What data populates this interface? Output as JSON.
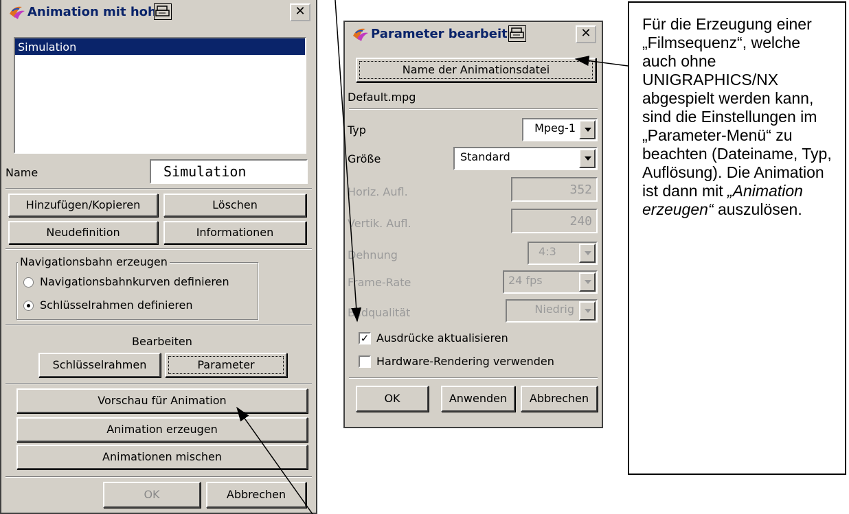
{
  "dialog1": {
    "title": "Animation mit hoher Bildqual",
    "list_items": [
      "Simulation"
    ],
    "name_label": "Name",
    "name_value": "Simulation",
    "btn_add_copy": "Hinzufügen/Kopieren",
    "btn_delete": "Löschen",
    "btn_redefine": "Neudefinition",
    "btn_info": "Informationen",
    "group_title": "Navigationsbahn erzeugen",
    "radio_curves": "Navigationsbahnkurven definieren",
    "radio_keyframes": "Schlüsselrahmen definieren",
    "edit_label": "Bearbeiten",
    "btn_keyframes": "Schlüsselrahmen",
    "btn_parameter": "Parameter",
    "btn_preview": "Vorschau für Animation",
    "btn_create": "Animation erzeugen",
    "btn_mix": "Animationen mischen",
    "btn_ok": "OK",
    "btn_cancel": "Abbrechen"
  },
  "dialog2": {
    "title": "Parameter bearbeit",
    "btn_filename": "Name der Animationsdatei",
    "filename": "Default.mpg",
    "type_label": "Typ",
    "type_value": "Mpeg-1",
    "size_label": "Größe",
    "size_value": "Standard",
    "hres_label": "Horiz. Aufl.",
    "hres_value": "352",
    "vres_label": "Vertik. Aufl.",
    "vres_value": "240",
    "aspect_label": "Dehnung",
    "aspect_value": "4:3",
    "framerate_label": "Frame-Rate",
    "framerate_value": "24 fps",
    "quality_label": "Bildqualität",
    "quality_value": "Niedrig",
    "cb_expressions": "Ausdrücke aktualisieren",
    "cb_expressions_checked": true,
    "cb_hardware": "Hardware-Rendering verwenden",
    "cb_hardware_checked": false,
    "btn_ok": "OK",
    "btn_apply": "Anwenden",
    "btn_cancel": "Abbrechen"
  },
  "note": {
    "text_plain": "Für die Erzeugung einer „Filmsequenz“, welche auch ohne UNIGRAPHICS/NX abgespielt werden kann, sind die Einstellungen im „Parameter-Menü“ zu beachten (Dateiname, Typ, Auflösung). Die Animation ist dann mit ",
    "text_italic": "„Animation erzeugen“",
    "text_end": " auszulösen."
  }
}
